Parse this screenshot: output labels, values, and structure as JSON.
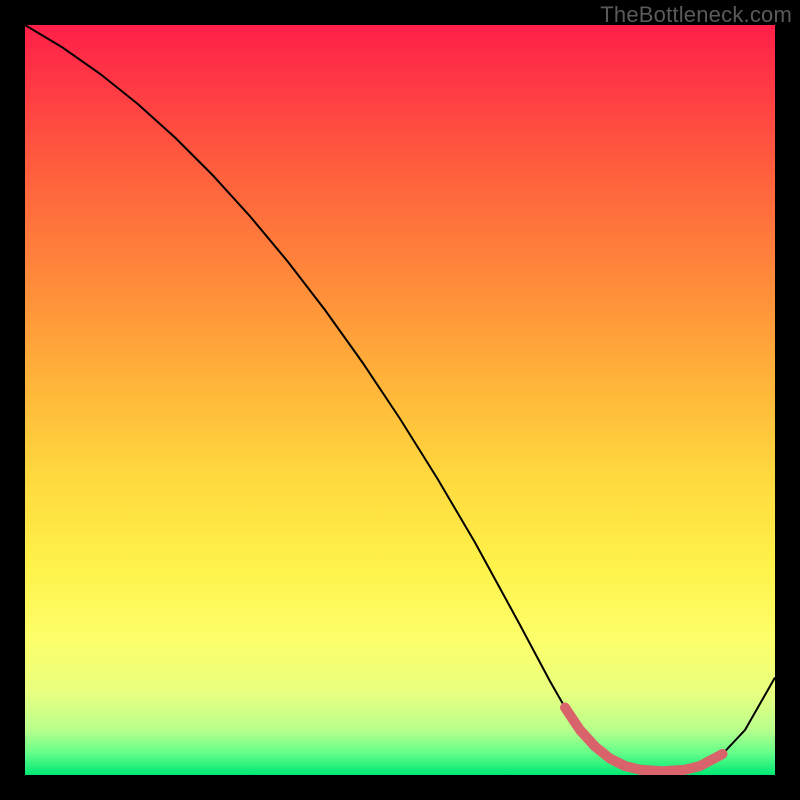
{
  "watermark": "TheBottleneck.com",
  "chart_data": {
    "type": "line",
    "title": "",
    "xlabel": "",
    "ylabel": "",
    "xlim": [
      0,
      100
    ],
    "ylim": [
      0,
      100
    ],
    "grid": false,
    "legend": false,
    "series": [
      {
        "name": "bottleneck-curve",
        "color": "#000000",
        "stroke_width": 2,
        "x": [
          0,
          5,
          10,
          15,
          20,
          25,
          30,
          35,
          40,
          45,
          50,
          55,
          60,
          63,
          66,
          70,
          72,
          74,
          76,
          78,
          80,
          82,
          85,
          88,
          90,
          93,
          96,
          100
        ],
        "y": [
          100,
          97,
          93.5,
          89.5,
          85,
          80,
          74.5,
          68.5,
          62,
          55,
          47.5,
          39.5,
          31,
          25.5,
          20,
          12.5,
          9,
          6,
          3.8,
          2.2,
          1.2,
          0.7,
          0.5,
          0.7,
          1.2,
          2.8,
          6,
          13
        ]
      },
      {
        "name": "optimal-range",
        "color": "#d9636a",
        "stroke_width": 10,
        "linecap": "round",
        "x": [
          72,
          74,
          76,
          78,
          80,
          82,
          85,
          88,
          90,
          93
        ],
        "y": [
          9,
          6,
          3.8,
          2.2,
          1.2,
          0.7,
          0.5,
          0.7,
          1.2,
          2.8
        ]
      }
    ],
    "background_gradient_stops": [
      {
        "pos": 0.0,
        "color": "#ff1f49"
      },
      {
        "pos": 0.18,
        "color": "#ff5a3e"
      },
      {
        "pos": 0.34,
        "color": "#ff8a3a"
      },
      {
        "pos": 0.48,
        "color": "#ffb53a"
      },
      {
        "pos": 0.6,
        "color": "#ffd83e"
      },
      {
        "pos": 0.72,
        "color": "#fff24a"
      },
      {
        "pos": 0.82,
        "color": "#fdff6a"
      },
      {
        "pos": 0.89,
        "color": "#e8ff80"
      },
      {
        "pos": 0.94,
        "color": "#b8ff8c"
      },
      {
        "pos": 0.97,
        "color": "#66ff8a"
      },
      {
        "pos": 1.0,
        "color": "#00e874"
      }
    ]
  }
}
